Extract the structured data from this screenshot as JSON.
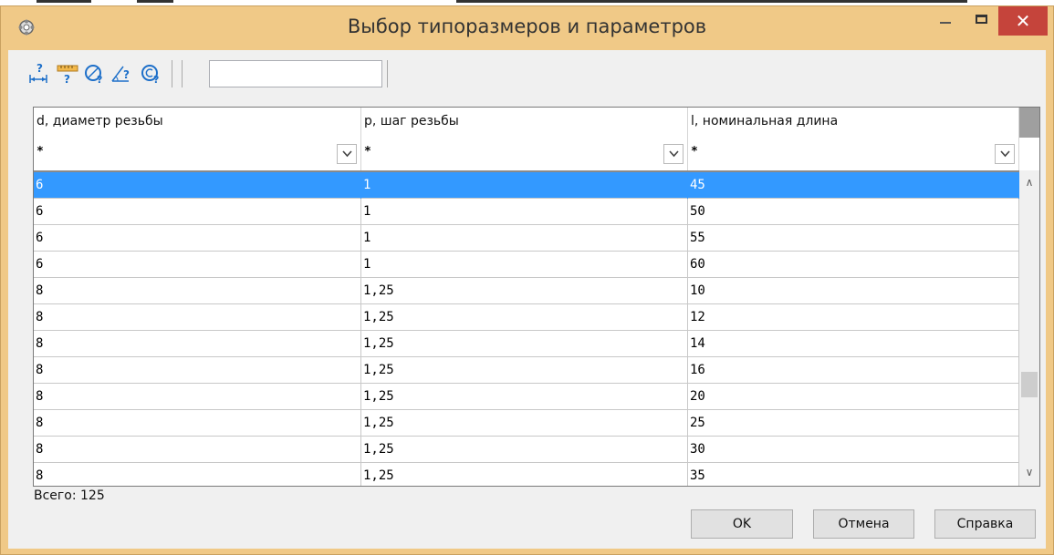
{
  "window": {
    "title": "Выбор типоразмеров и параметров",
    "close_glyph": "✕",
    "icon": "gear-icon"
  },
  "toolbar": {
    "icons": [
      "dimension-query-icon",
      "ruler-query-icon",
      "diameter-query-icon",
      "angle-query-icon",
      "copyright-query-icon"
    ],
    "search_value": ""
  },
  "table": {
    "columns": [
      {
        "header": "d, диаметр резьбы",
        "filter": "*"
      },
      {
        "header": "p, шаг резьбы",
        "filter": "*"
      },
      {
        "header": "l, номинальная длина",
        "filter": "*"
      }
    ],
    "rows": [
      [
        "6",
        "1",
        "45"
      ],
      [
        "6",
        "1",
        "50"
      ],
      [
        "6",
        "1",
        "55"
      ],
      [
        "6",
        "1",
        "60"
      ],
      [
        "8",
        "1,25",
        "10"
      ],
      [
        "8",
        "1,25",
        "12"
      ],
      [
        "8",
        "1,25",
        "14"
      ],
      [
        "8",
        "1,25",
        "16"
      ],
      [
        "8",
        "1,25",
        "20"
      ],
      [
        "8",
        "1,25",
        "25"
      ],
      [
        "8",
        "1,25",
        "30"
      ],
      [
        "8",
        "1,25",
        "35"
      ]
    ],
    "selected_row": 0,
    "scroll_up_glyph": "∧",
    "scroll_down_glyph": "∨"
  },
  "footer": {
    "total_label": "Всего: 125",
    "ok_label": "OK",
    "cancel_label": "Отмена",
    "help_label": "Справка"
  },
  "colors": {
    "frame": "#f0c987",
    "selection": "#3399ff",
    "close_button": "#c5443b"
  }
}
